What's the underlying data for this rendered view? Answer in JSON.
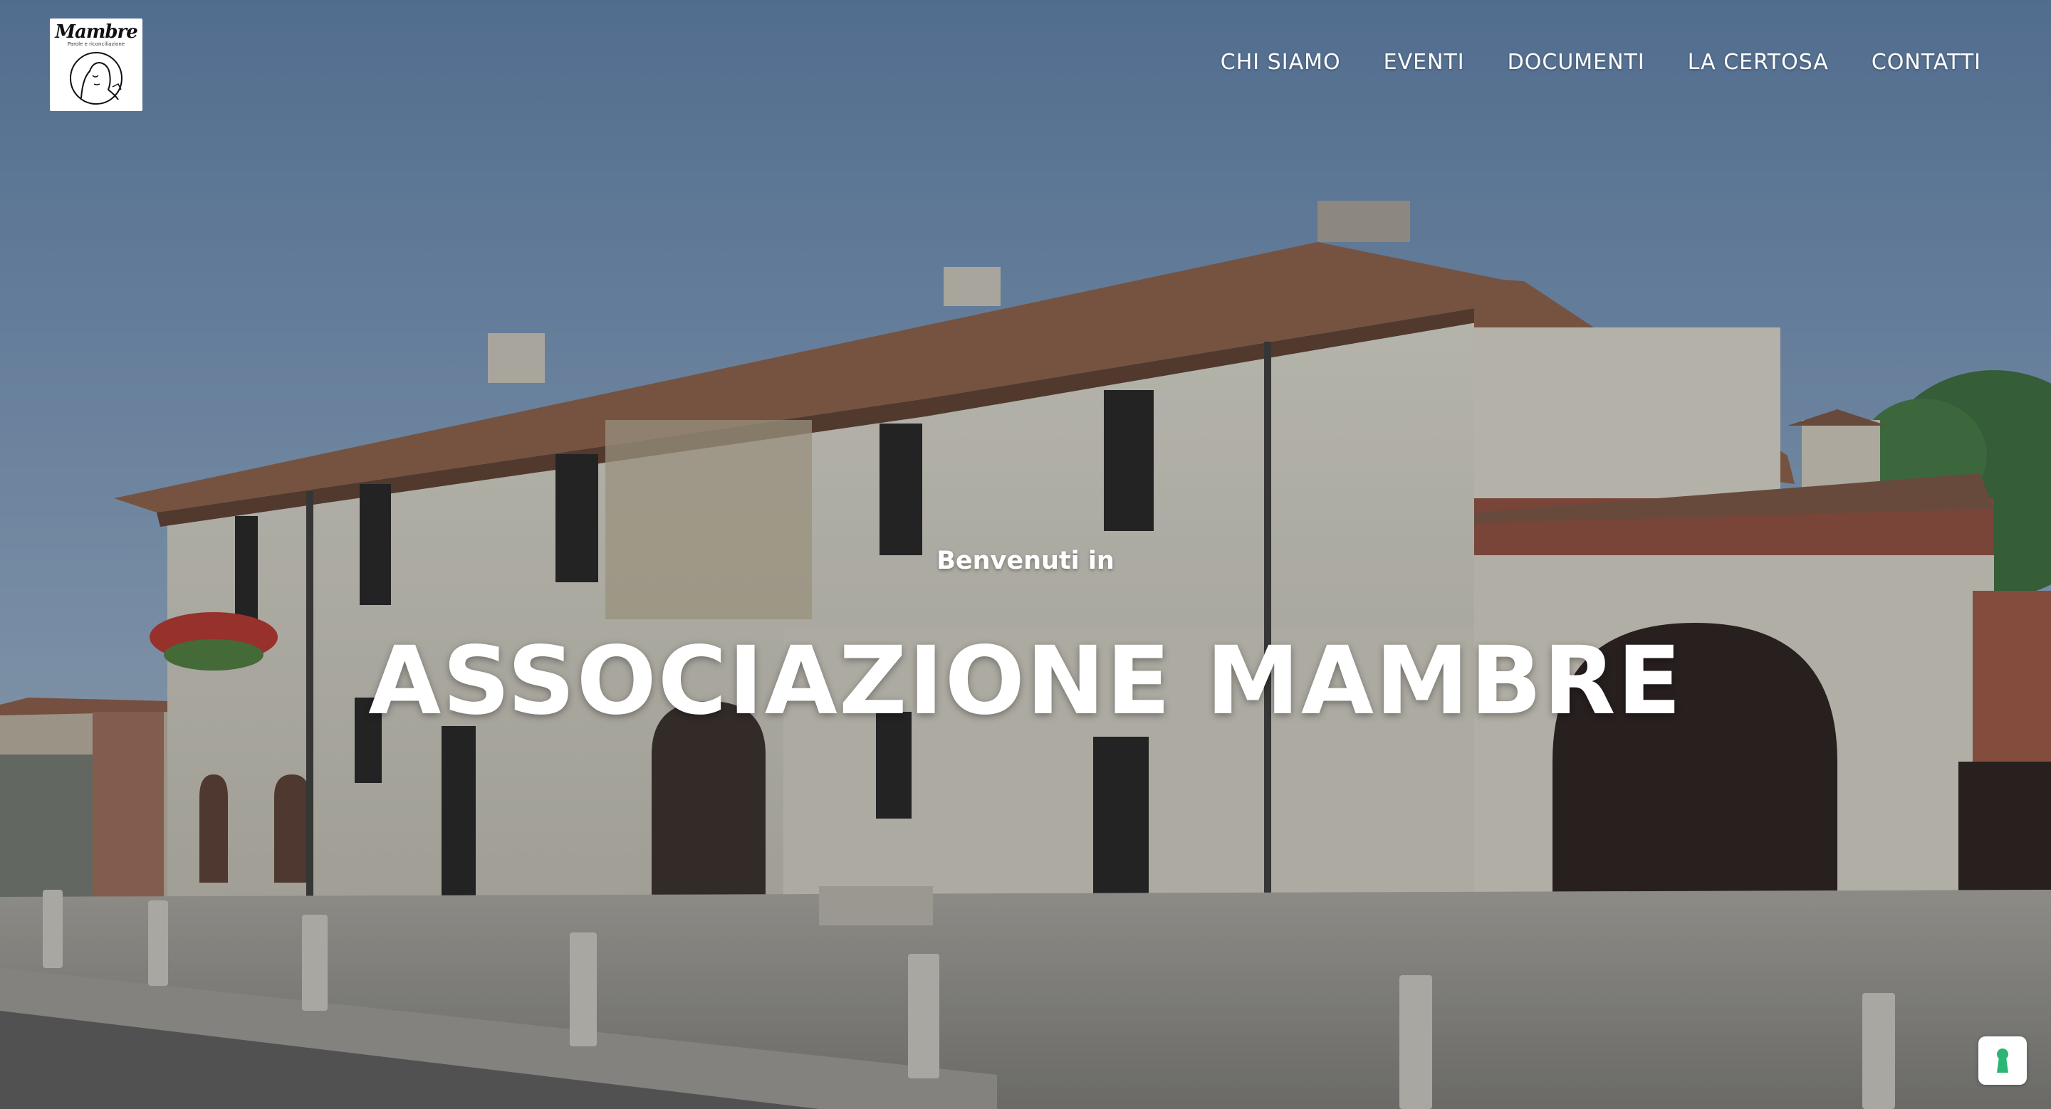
{
  "brand": {
    "logo_wordmark": "Mambre",
    "logo_tagline": "Parole e riconciliazione"
  },
  "nav": {
    "items": [
      {
        "label": "CHI SIAMO"
      },
      {
        "label": "EVENTI"
      },
      {
        "label": "DOCUMENTI"
      },
      {
        "label": "LA CERTOSA"
      },
      {
        "label": "CONTATTI"
      }
    ]
  },
  "hero": {
    "welcome": "Benvenuti in",
    "title": "ASSOCIAZIONE MAMBRE"
  },
  "icons": {
    "privacy": "keyhole-icon"
  },
  "colors": {
    "sky": "#6f8aa9",
    "text": "#ffffff",
    "privacy_accent": "#2bb673"
  }
}
